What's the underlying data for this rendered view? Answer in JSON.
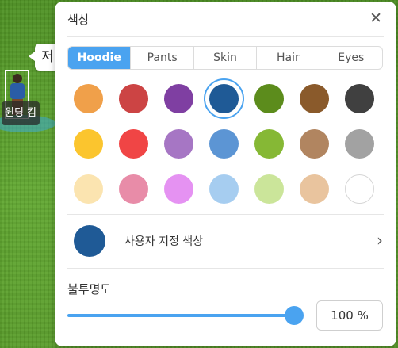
{
  "scene": {
    "speech_text": "저",
    "nametag": "원딩 킴"
  },
  "panel": {
    "title": "색상",
    "close_symbol": "✕",
    "tabs": [
      {
        "label": "Hoodie",
        "active": true
      },
      {
        "label": "Pants",
        "active": false
      },
      {
        "label": "Skin",
        "active": false
      },
      {
        "label": "Hair",
        "active": false
      },
      {
        "label": "Eyes",
        "active": false
      }
    ],
    "swatches": [
      [
        "#f0a04a",
        "#cc4444",
        "#7f3fa2",
        "#1f5a96",
        "#5c8c1c",
        "#8a5a2b",
        "#404040"
      ],
      [
        "#fbc52e",
        "#f04545",
        "#a676c4",
        "#5c95d4",
        "#86b835",
        "#b18560",
        "#a2a2a2"
      ],
      [
        "#fbe4b0",
        "#e88ca8",
        "#e592f2",
        "#a6cdf0",
        "#cbe59a",
        "#e9c49e",
        "#ffffff"
      ]
    ],
    "selected_color": "#1f5a96",
    "custom_color": {
      "label": "사용자 지정 색상",
      "chevron": "›",
      "color": "#1f5a96"
    },
    "opacity": {
      "label": "불투명도",
      "value_text": "100 %",
      "value": 100,
      "accent": "#4aa3f0"
    }
  }
}
